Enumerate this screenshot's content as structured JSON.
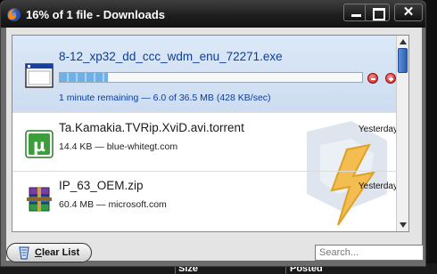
{
  "window": {
    "title": "16% of 1 file - Downloads",
    "close_glyph": "✕"
  },
  "downloads": [
    {
      "name": "8-12_xp32_dd_ccc_wdm_enu_72271.exe",
      "status": "1 minute remaining — 6.0 of 36.5 MB (428 KB/sec)",
      "progress": 0.16,
      "icon": "exe-window-icon",
      "state": "downloading"
    },
    {
      "name": "Ta.Kamakia.TVRip.XviD.avi.torrent",
      "status": "14.4 KB — blue-whitegt.com",
      "date": "Yesterday",
      "icon": "utorrent-icon"
    },
    {
      "name": "IP_63_OEM.zip",
      "status": "60.4 MB — microsoft.com",
      "date": "Yesterday",
      "icon": "winrar-archive-icon"
    }
  ],
  "footer": {
    "clear_list_label": "Clear List",
    "clear_list_accesskey": "C",
    "clear_list_rest": "lear List",
    "search_placeholder": "Search..."
  },
  "background": {
    "col_size": "Size",
    "col_posted": "Posted"
  },
  "colors": {
    "accent_link": "#0b3e99",
    "selected_row": "#d4e2f4",
    "progress_fill": "#6fb0e6",
    "cancel_red": "#c81d1d"
  }
}
